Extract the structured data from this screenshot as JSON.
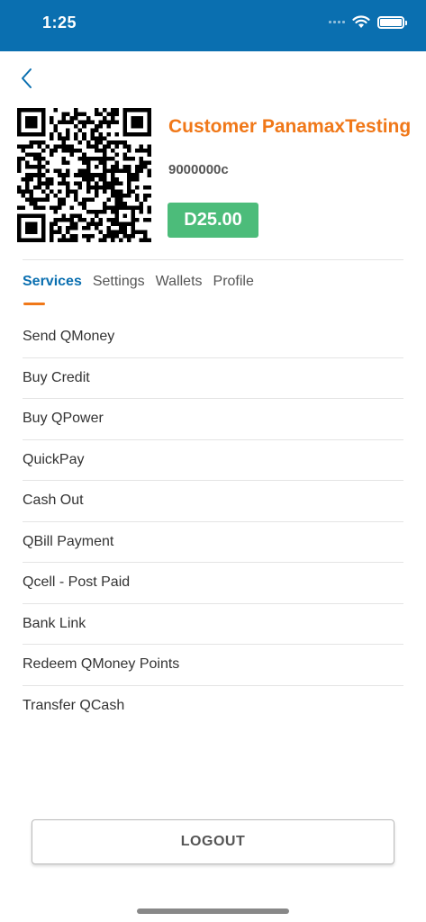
{
  "status_bar": {
    "time": "1:25",
    "icons": [
      "signal-icon",
      "wifi-icon",
      "battery-icon"
    ]
  },
  "nav": {
    "back_icon": "chevron-left-icon"
  },
  "profile": {
    "qr_code": "qr-code-icon",
    "name": "Customer PanamaxTesting",
    "account_id": "9000000c",
    "balance": "D25.00"
  },
  "tabs": [
    {
      "label": "Services",
      "active": true
    },
    {
      "label": "Settings",
      "active": false
    },
    {
      "label": "Wallets",
      "active": false
    },
    {
      "label": "Profile",
      "active": false
    }
  ],
  "services": [
    "Send QMoney",
    "Buy Credit",
    "Buy QPower",
    "QuickPay",
    "Cash Out",
    "QBill Payment",
    "Qcell - Post Paid",
    "Bank Link",
    "Redeem QMoney Points",
    "Transfer QCash"
  ],
  "logout_label": "LOGOUT",
  "colors": {
    "header": "#0a6fb0",
    "accent": "#f07819",
    "balance": "#4cbc7a",
    "active_tab": "#0a6fb0"
  }
}
